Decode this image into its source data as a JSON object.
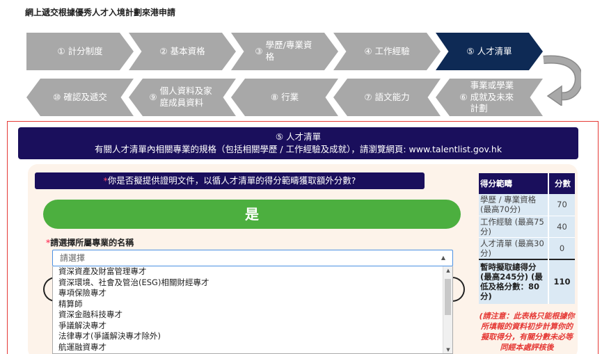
{
  "page": {
    "title": "網上遞交根據優秀人才入境計劃來港申請"
  },
  "steps": {
    "row1": [
      {
        "num": "①",
        "label": "計分制度"
      },
      {
        "num": "②",
        "label": "基本資格"
      },
      {
        "num": "③",
        "label": "學歷/專業資格"
      },
      {
        "num": "④",
        "label": "工作經驗"
      },
      {
        "num": "⑤",
        "label": "人才清單"
      }
    ],
    "row2": [
      {
        "num": "⑩",
        "label": "確認及遞交"
      },
      {
        "num": "⑨",
        "label": "個人資料及家庭成員資料"
      },
      {
        "num": "⑧",
        "label": "行業"
      },
      {
        "num": "⑦",
        "label": "語文能力"
      },
      {
        "num": "⑥",
        "label": "事業或學業成就及未來計劃"
      }
    ]
  },
  "banner": {
    "title": "⑤ 人才清單",
    "subtitle": "有關人才清單內相關專業的規格（包括相關學歷 / 工作經驗及成就），請瀏覽網頁: www.talentlist.gov.hk"
  },
  "question": {
    "required_mark": "*",
    "text": "你是否擬提供證明文件，以循人才清單的得分範疇獲取額外分數?"
  },
  "yes_button": {
    "label": "是"
  },
  "profession_select": {
    "required_mark": "*",
    "label": "請選擇所屬專業的名稱",
    "placeholder": "請選擇",
    "options": [
      "資深資產及財富管理專才",
      "資深環境、社會及管治(ESG)相關財經專才",
      "專項保險專才",
      "精算師",
      "資深金融科技專才",
      "爭議解決專才",
      "法律專才(爭議解決專才除外)",
      "航運融資專才"
    ]
  },
  "score_table": {
    "headers": {
      "category": "得分範疇",
      "points": "分數"
    },
    "rows": [
      {
        "label": "學歷 / 專業資格 (最高70分)",
        "points": "70"
      },
      {
        "label": "工作經驗 (最高75分)",
        "points": "40"
      },
      {
        "label": "人才清單 (最高30分)",
        "points": "0"
      }
    ],
    "total": {
      "label": "暫時擬取總得分 (最高245分) (最低及格分數：80分)",
      "points": "110"
    },
    "note": "(請注意：此表格只能根據你所填報的資料初步計算你的擬取得分，有關分數未必等同經本處評核後"
  },
  "colors": {
    "accent": "#1a0f5c",
    "active_step": "#0e2a55",
    "step": "#a8a8a8",
    "yes": "#4caf3f",
    "frame": "#e53935"
  }
}
